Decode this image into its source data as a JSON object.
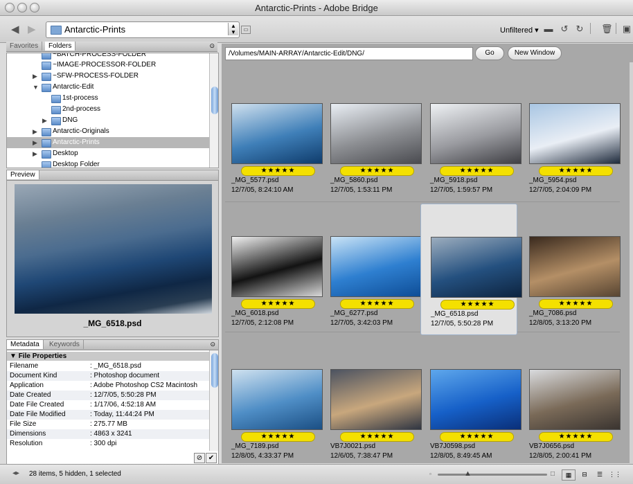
{
  "window": {
    "title": "Antarctic-Prints - Adobe Bridge"
  },
  "toolbar": {
    "path_label": "Antarctic-Prints",
    "filter_label": "Unfiltered"
  },
  "folder_panel": {
    "tabs": [
      "Favorites",
      "Folders"
    ],
    "items": [
      {
        "label": "~BATCH-PROCESS-FOLDER"
      },
      {
        "label": "~IMAGE-PROCESSOR-FOLDER"
      },
      {
        "label": "~SFW-PROCESS-FOLDER"
      },
      {
        "label": "Antarctic-Edit"
      },
      {
        "label": "1st-process"
      },
      {
        "label": "2nd-process"
      },
      {
        "label": "DNG"
      },
      {
        "label": "Antarctic-Originals"
      },
      {
        "label": "Antarctic-Prints"
      },
      {
        "label": "Desktop"
      },
      {
        "label": "Desktop Folder"
      }
    ]
  },
  "preview": {
    "tab": "Preview",
    "caption": "_MG_6518.psd"
  },
  "metadata": {
    "tabs": [
      "Metadata",
      "Keywords"
    ],
    "section": "File Properties",
    "rows": [
      {
        "key": "Filename",
        "value": ": _MG_6518.psd"
      },
      {
        "key": "Document Kind",
        "value": ": Photoshop document"
      },
      {
        "key": "Application",
        "value": ": Adobe Photoshop CS2 Macintosh"
      },
      {
        "key": "Date Created",
        "value": ": 12/7/05, 5:50:28 PM"
      },
      {
        "key": "Date File Created",
        "value": ": 1/17/06, 4:52:18 AM"
      },
      {
        "key": "Date File Modified",
        "value": ": Today, 11:44:24 PM"
      },
      {
        "key": "File Size",
        "value": ": 275.77 MB"
      },
      {
        "key": "Dimensions",
        "value": ": 4863 x 3241"
      },
      {
        "key": "Resolution",
        "value": ": 300 dpi"
      }
    ]
  },
  "content": {
    "address": "/Volumes/MAIN-ARRAY/Antarctic-Edit/DNG/",
    "go_label": "Go",
    "new_window_label": "New Window",
    "rating_text": "★★★★★",
    "thumbnails": [
      {
        "name": "_MG_5577.psd",
        "date": "12/7/05, 8:24:10 AM",
        "colors": [
          "#cfe0ee",
          "#3f7fb8",
          "#0f3c6c"
        ]
      },
      {
        "name": "_MG_5860.psd",
        "date": "12/7/05, 1:53:11 PM",
        "colors": [
          "#e9eef4",
          "#8d8f93",
          "#4a4b50"
        ]
      },
      {
        "name": "_MG_5918.psd",
        "date": "12/7/05, 1:59:57 PM",
        "colors": [
          "#eef1f4",
          "#9a9ba0",
          "#3f3f44"
        ]
      },
      {
        "name": "_MG_5954.psd",
        "date": "12/7/05, 2:04:09 PM",
        "colors": [
          "#a9c6e3",
          "#e9eef5",
          "#1e2a3c"
        ]
      },
      {
        "name": "_MG_6018.psd",
        "date": "12/7/05, 2:12:08 PM",
        "colors": [
          "#f0f0f0",
          "#131313",
          "#d8d8d8"
        ]
      },
      {
        "name": "_MG_6277.psd",
        "date": "12/7/05, 3:42:03 PM",
        "colors": [
          "#c9e3f6",
          "#2e7fd0",
          "#0e4d96"
        ]
      },
      {
        "name": "_MG_6518.psd",
        "date": "12/7/05, 5:50:28 PM",
        "colors": [
          "#9cadbe",
          "#24507f",
          "#0d2440"
        ]
      },
      {
        "name": "_MG_7086.psd",
        "date": "12/8/05, 3:13:20 PM",
        "colors": [
          "#3a2a1e",
          "#b48f66",
          "#584532"
        ]
      },
      {
        "name": "_MG_7189.psd",
        "date": "12/8/05, 4:33:37 PM",
        "colors": [
          "#cfe1ef",
          "#4f8ec6",
          "#1b4f84"
        ]
      },
      {
        "name": "VB7J0021.psd",
        "date": "12/6/05, 7:38:47 PM",
        "colors": [
          "#4c5361",
          "#c8a77d",
          "#2f3542"
        ]
      },
      {
        "name": "VB7J0598.psd",
        "date": "12/8/05, 8:49:45 AM",
        "colors": [
          "#5ea7ec",
          "#1660c8",
          "#0a2f78"
        ]
      },
      {
        "name": "VB7J0656.psd",
        "date": "12/8/05, 2:00:41 PM",
        "colors": [
          "#d9dbde",
          "#7a6a58",
          "#3a3430"
        ]
      }
    ],
    "selected_index": 6
  },
  "status": {
    "text": "28 items, 5 hidden, 1 selected"
  }
}
